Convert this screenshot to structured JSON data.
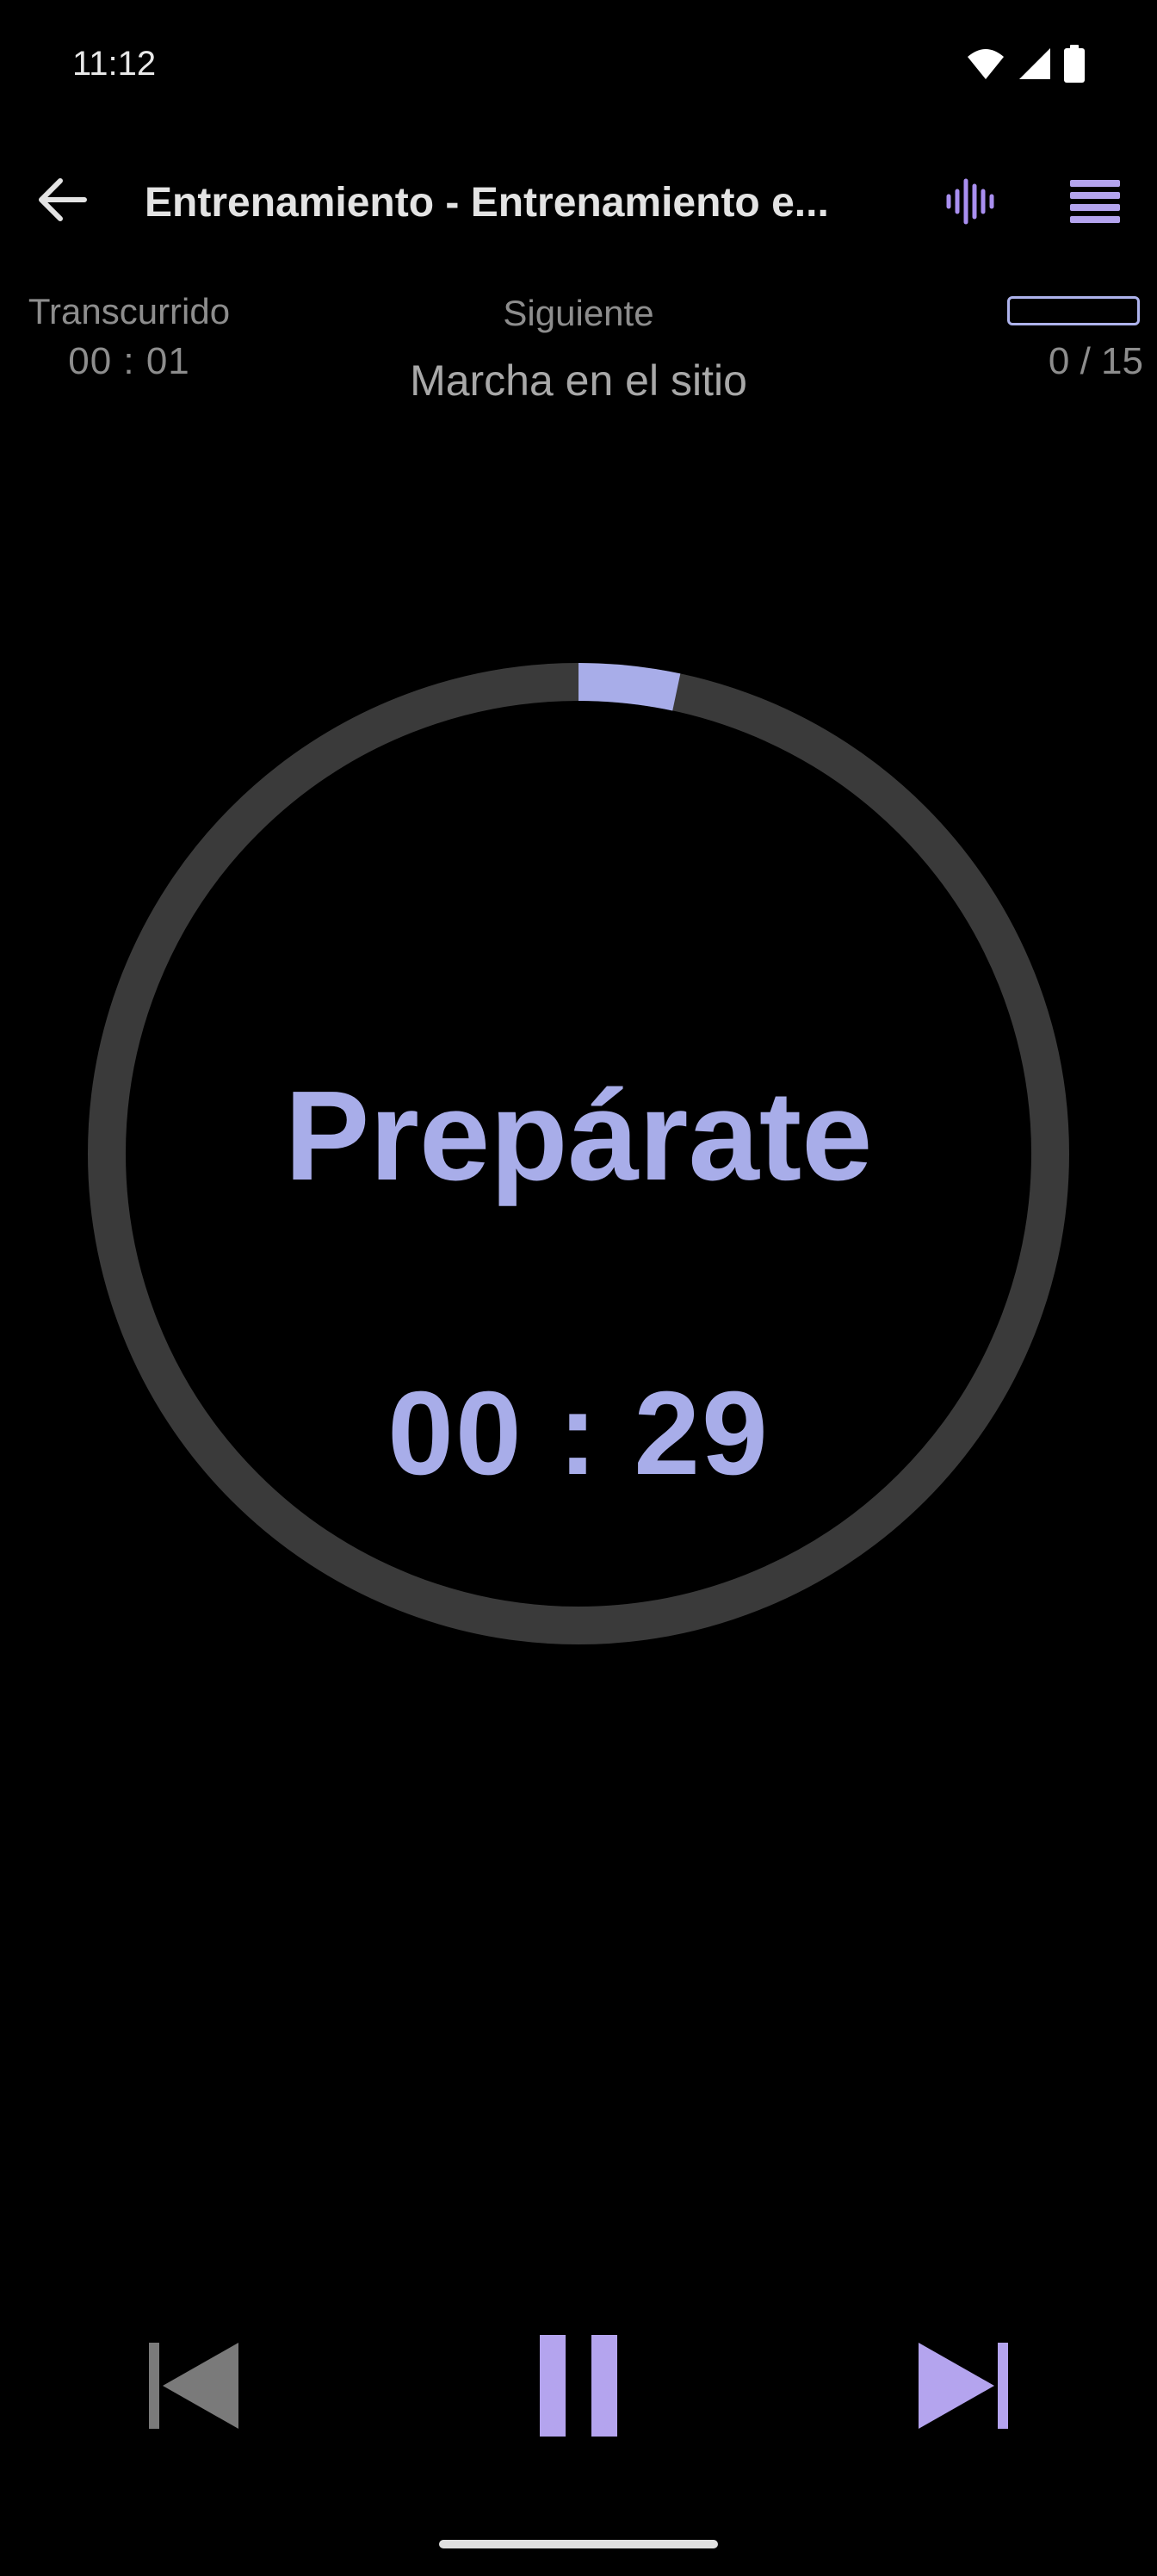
{
  "status_bar": {
    "time": "11:12",
    "icons": [
      "wifi-icon",
      "signal-icon",
      "battery-icon"
    ]
  },
  "app_bar": {
    "back_icon": "arrow-left-icon",
    "title": "Entrenamiento - Entrenamiento e...",
    "voice_icon": "sound-wave-icon",
    "list_icon": "list-icon"
  },
  "info": {
    "elapsed_label": "Transcurrido",
    "elapsed_value": "00 : 01",
    "next_label": "Siguiente",
    "next_value": "Marcha en el sitio",
    "exercise_count": "0 / 15",
    "exercise_progress": 0
  },
  "timer": {
    "phase": "Prepárate",
    "remaining": "00 : 29",
    "progress_fraction": 0.0333
  },
  "controls": {
    "previous_icon": "skip-previous-icon",
    "pause_icon": "pause-icon",
    "next_icon": "skip-next-icon"
  },
  "colors": {
    "background": "#000000",
    "accent": "#a8ade9",
    "control_accent": "#b4a4ee",
    "ring_track": "#3a3a3a",
    "muted_text": "#8d8d8d",
    "disabled_control": "#7a7a7a"
  }
}
